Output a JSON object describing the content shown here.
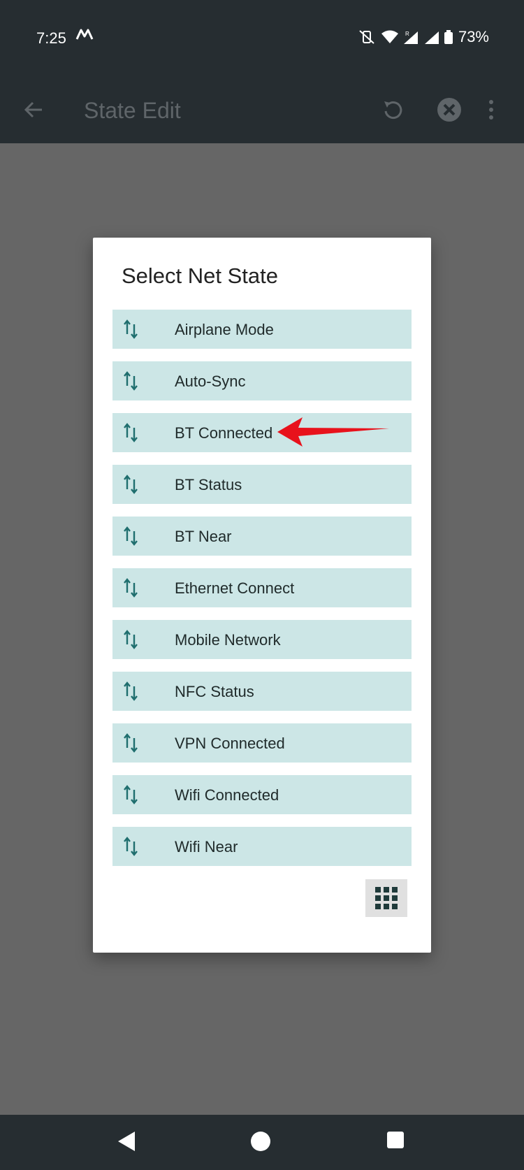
{
  "status": {
    "time": "7:25",
    "battery": "73%"
  },
  "appbar": {
    "title": "State Edit"
  },
  "dialog": {
    "title": "Select Net State",
    "options": [
      {
        "label": "Airplane Mode"
      },
      {
        "label": "Auto-Sync"
      },
      {
        "label": "BT Connected"
      },
      {
        "label": "BT Status"
      },
      {
        "label": "BT Near"
      },
      {
        "label": "Ethernet Connect"
      },
      {
        "label": "Mobile Network"
      },
      {
        "label": "NFC Status"
      },
      {
        "label": "VPN Connected"
      },
      {
        "label": "Wifi Connected"
      },
      {
        "label": "Wifi Near"
      }
    ]
  },
  "colors": {
    "option_bg": "#cce6e6",
    "accent": "#1f6e6e",
    "arrow": "#e8121c"
  },
  "icons": {
    "option_icon": "up-down-arrows-icon",
    "grid_button": "grid-icon"
  }
}
